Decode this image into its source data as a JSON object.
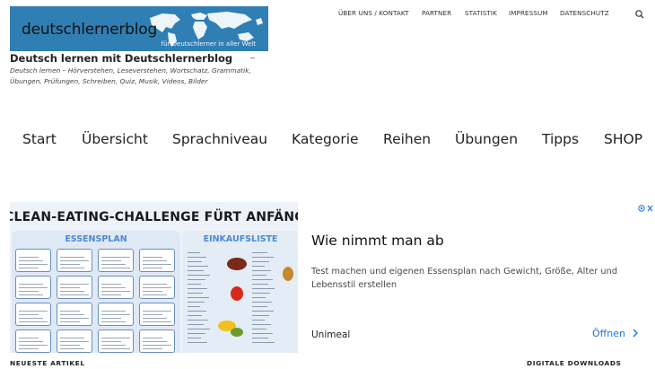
{
  "header": {
    "logo_text": "deutschlernerblog",
    "logo_tagline": "für Deutschlerner in aller Welt",
    "site_title": "Deutsch lernen mit Deutschlernerblog",
    "site_title_suffix": "–",
    "site_description": "Deutsch lernen – Hörverstehen, Leseverstehen, Wortschatz, Grammatik, Übungen, Prüfungen, Schreiben, Quiz, Musik, Videos, Bilder"
  },
  "top_nav": {
    "items": [
      "ÜBER UNS / KONTAKT",
      "PARTNER",
      "STATISTIK",
      "IMPRESSUM",
      "DATENSCHUTZ"
    ],
    "search_icon": "search-icon"
  },
  "main_menu": {
    "items": [
      "Start",
      "Übersicht",
      "Sprachniveau",
      "Kategorie",
      "Reihen",
      "Übungen",
      "Tipps",
      "SHOP"
    ]
  },
  "ad": {
    "image_headline": "CLEAN-EATING-CHALLENGE FÜRT ANFÄNGER",
    "panel_left_title": "ESSENSPLAN",
    "panel_right_title": "EINKAUFSLISTE",
    "title": "Wie nimmt man ab",
    "body": "Test machen und eigenen Essensplan nach Gewicht, Größe, Alter und Lebensstil erstellen",
    "brand": "Unimeal",
    "cta": "Öffnen",
    "cta_icon": "chevron-right-icon",
    "adchoices_icon": "adchoices-icon",
    "colors": {
      "cta": "#1a73e8",
      "panel_title": "#4a8ad4"
    }
  },
  "sections": {
    "left": "NEUESTE ARTIKEL",
    "right": "DIGITALE DOWNLOADS"
  }
}
